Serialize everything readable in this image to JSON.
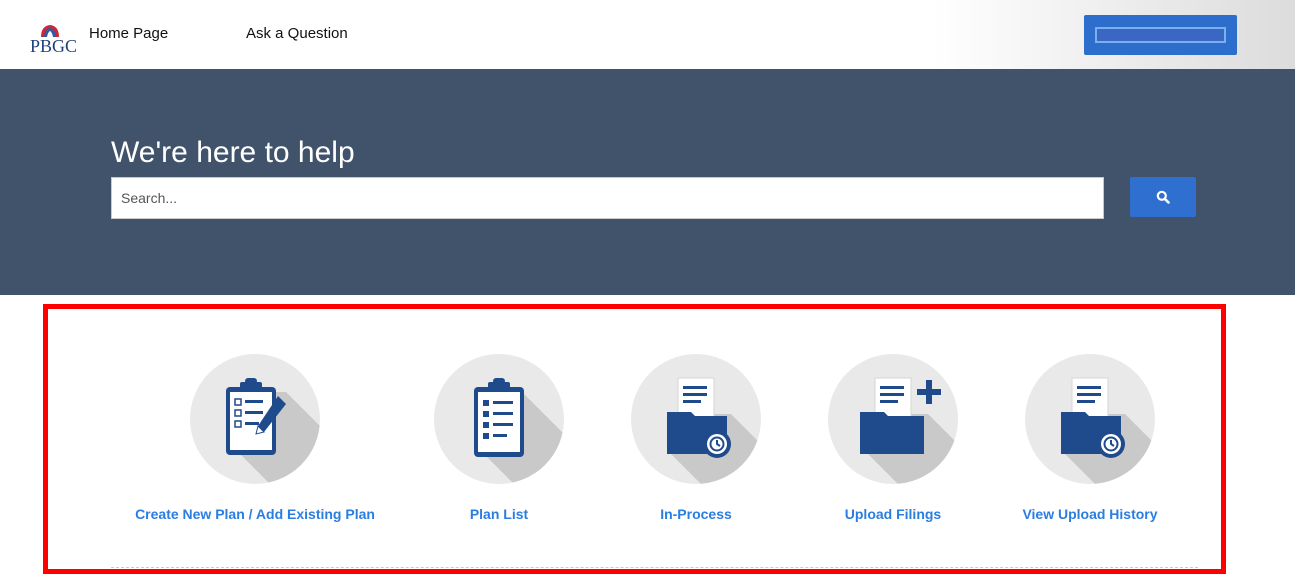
{
  "header": {
    "logo_text": "PBGC",
    "nav": [
      {
        "label": "Home Page"
      },
      {
        "label": "Ask a Question"
      }
    ]
  },
  "hero": {
    "title": "We're here to help",
    "search_placeholder": "Search...",
    "search_icon": "search-icon"
  },
  "tiles": [
    {
      "label": "Create New Plan / Add Existing Plan",
      "icon": "clipboard-checklist-pencil-icon"
    },
    {
      "label": "Plan List",
      "icon": "clipboard-checklist-icon"
    },
    {
      "label": "In-Process",
      "icon": "folder-history-icon"
    },
    {
      "label": "Upload Filings",
      "icon": "folder-add-icon"
    },
    {
      "label": "View Upload History",
      "icon": "folder-history-icon"
    }
  ],
  "colors": {
    "hero_bg": "#41536b",
    "accent_blue": "#2f6fd0",
    "link_blue": "#2a7de1",
    "icon_navy": "#1f4b8c",
    "highlight_red": "#ff0000"
  }
}
